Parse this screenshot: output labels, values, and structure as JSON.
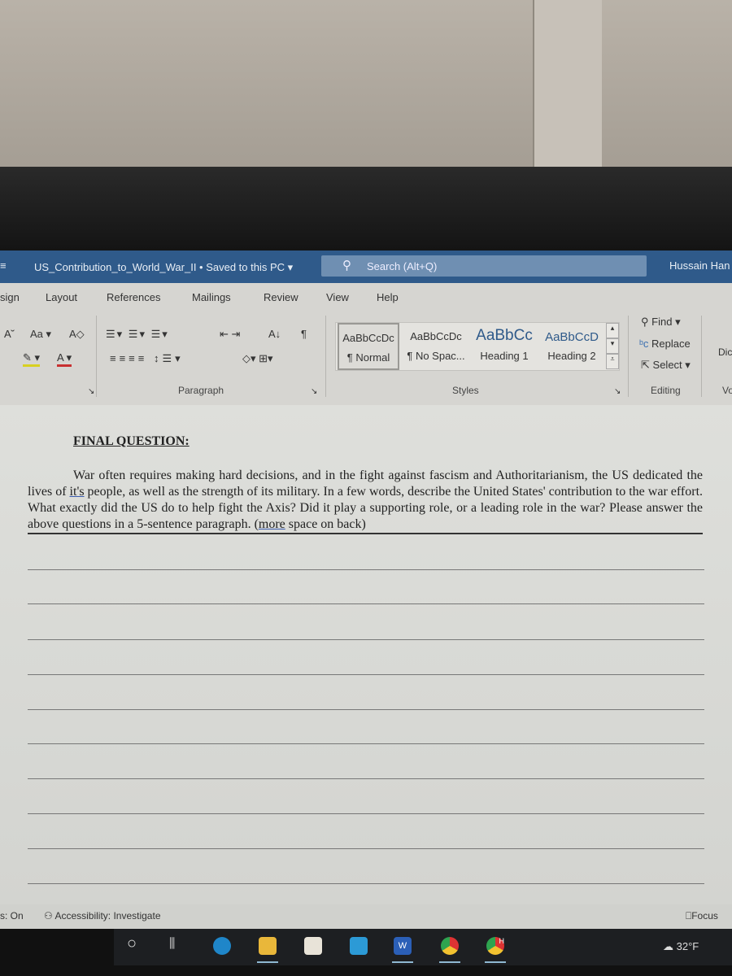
{
  "window": {
    "doc_title": "US_Contribution_to_World_War_II • Saved to this PC",
    "title_dropdown": "▾",
    "search_placeholder": "Search (Alt+Q)",
    "user": "Hussain Han"
  },
  "ribbon": {
    "tabs": [
      "sign",
      "Layout",
      "References",
      "Mailings",
      "Review",
      "View",
      "Help"
    ],
    "groups": {
      "paragraph": "Paragraph",
      "styles": "Styles",
      "editing": "Editing",
      "voice": "Vo"
    },
    "font_tools": {
      "grow": "A˘",
      "case": "Aa ▾",
      "clear": "A◇",
      "highlight": "✎ ▾",
      "font_color": "A ▾"
    },
    "paragraph_tools": {
      "sort": "A↓",
      "pilcrow": "¶"
    },
    "styles": [
      {
        "preview": "AaBbCcDc",
        "name": "¶ Normal",
        "selected": true
      },
      {
        "preview": "AaBbCcDc",
        "name": "¶ No Spac...",
        "selected": false
      },
      {
        "preview": "AaBbCc",
        "name": "Heading 1",
        "selected": false
      },
      {
        "preview": "AaBbCcD",
        "name": "Heading 2",
        "selected": false
      }
    ],
    "editing": {
      "find": "Find",
      "replace": "Replace",
      "select": "Select"
    },
    "dictate": "Dic"
  },
  "document": {
    "heading": "FINAL QUESTION:",
    "para_1": "War often requires making hard decisions, and in the fight against fascism and Authoritarianism, the US dedicated the lives of ",
    "para_flag_1": "it's",
    "para_2": " people, as well as the strength of its military. In a few words, describe the United States' contribution to the war effort. What exactly did the US do to help fight the Axis? Did it play a supporting role, or a leading role in the war? Please answer the above questions in a 5-sentence paragraph. (",
    "para_flag_2": "more",
    "para_3": " space on back)"
  },
  "status": {
    "left": "s: On",
    "accessibility": "Accessibility: Investigate",
    "focus": "Focus"
  },
  "taskbar": {
    "weather": "32°F",
    "word_label": "W",
    "chrome_profile": "H"
  },
  "colors": {
    "titlebar": "#2f5a8a",
    "ribbon": "#d6d5d1",
    "taskbar": "#1d1f22"
  }
}
